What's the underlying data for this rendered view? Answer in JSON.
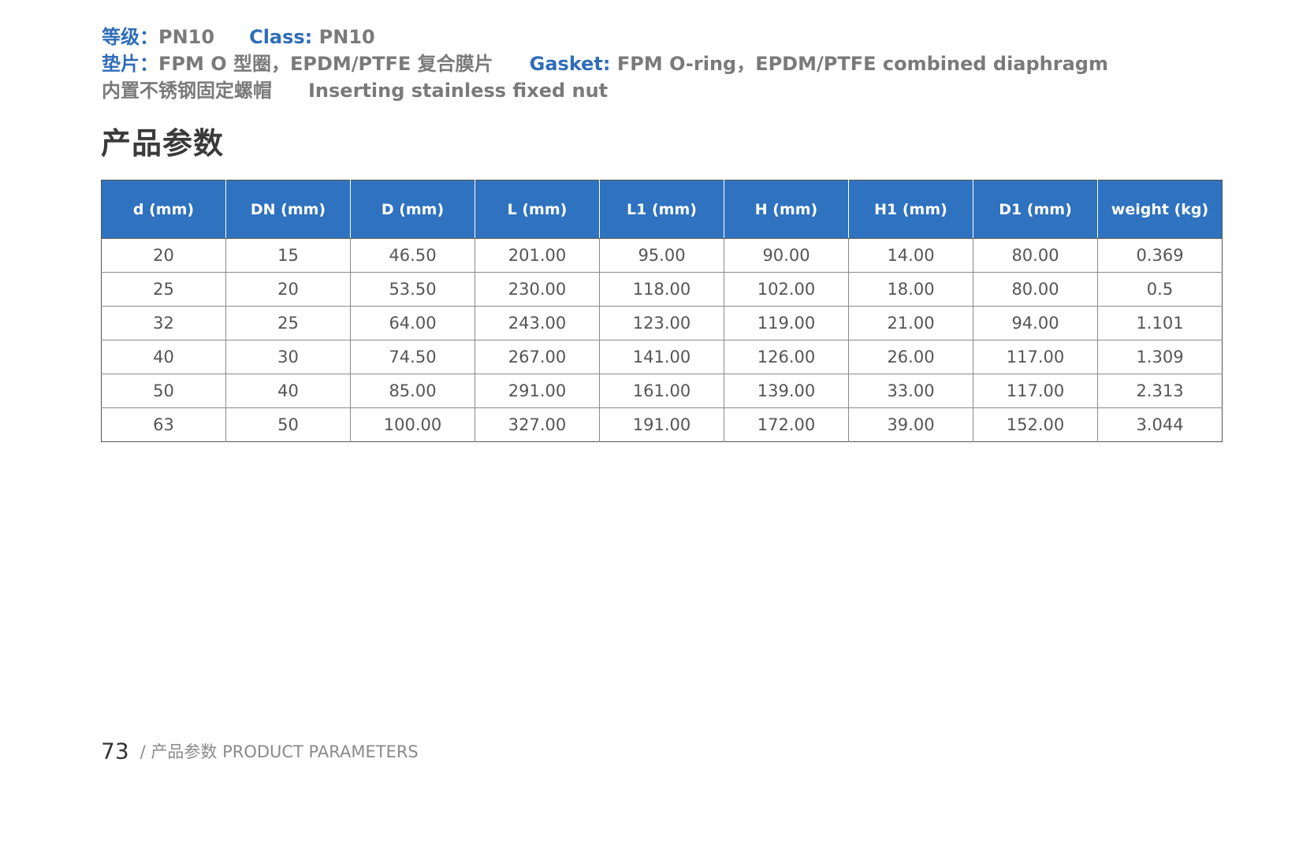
{
  "specs": {
    "grade_label": "等级：",
    "grade_value": "PN10",
    "class_label": "Class:",
    "class_value": "PN10",
    "gasket_cn_label": "垫片：",
    "gasket_cn_value": "FPM O 型圈，EPDM/PTFE 复合膜片",
    "gasket_en_label": "Gasket:",
    "gasket_en_value": "FPM O-ring，EPDM/PTFE combined diaphragm",
    "nut_cn": "内置不锈钢固定螺帽",
    "nut_en": "Inserting stainless fixed nut"
  },
  "section_title": "产品参数",
  "table": {
    "headers": [
      "d (mm)",
      "DN (mm)",
      "D (mm)",
      "L (mm)",
      "L1 (mm)",
      "H (mm)",
      "H1 (mm)",
      "D1 (mm)",
      "weight (kg)"
    ],
    "rows": [
      [
        "20",
        "15",
        "46.50",
        "201.00",
        "95.00",
        "90.00",
        "14.00",
        "80.00",
        "0.369"
      ],
      [
        "25",
        "20",
        "53.50",
        "230.00",
        "118.00",
        "102.00",
        "18.00",
        "80.00",
        "0.5"
      ],
      [
        "32",
        "25",
        "64.00",
        "243.00",
        "123.00",
        "119.00",
        "21.00",
        "94.00",
        "1.101"
      ],
      [
        "40",
        "30",
        "74.50",
        "267.00",
        "141.00",
        "126.00",
        "26.00",
        "117.00",
        "1.309"
      ],
      [
        "50",
        "40",
        "85.00",
        "291.00",
        "161.00",
        "139.00",
        "33.00",
        "117.00",
        "2.313"
      ],
      [
        "63",
        "50",
        "100.00",
        "327.00",
        "191.00",
        "172.00",
        "39.00",
        "152.00",
        "3.044"
      ]
    ]
  },
  "footer": {
    "page_number": "73",
    "text": "/ 产品参数  PRODUCT PARAMETERS"
  },
  "colors": {
    "accent_blue": "#2f72bf",
    "label_blue": "#2e6db8",
    "text_grey": "#7a7a7a"
  }
}
